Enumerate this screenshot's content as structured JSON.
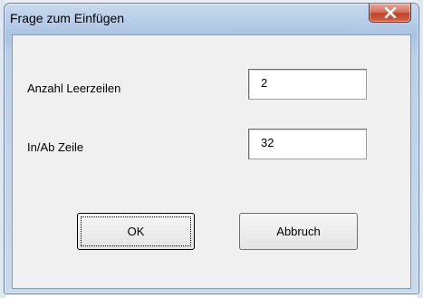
{
  "window": {
    "title": "Frage zum Einfügen",
    "close_icon": "close-icon"
  },
  "fields": [
    {
      "label": "Anzahl Leerzeilen",
      "value": "2"
    },
    {
      "label": "In/Ab Zeile",
      "value": "32"
    }
  ],
  "buttons": {
    "ok_label": "OK",
    "cancel_label": "Abbruch"
  },
  "colors": {
    "close_button": "#c7492f",
    "frame": "#b9cfe9",
    "client": "#f0f0f0"
  }
}
